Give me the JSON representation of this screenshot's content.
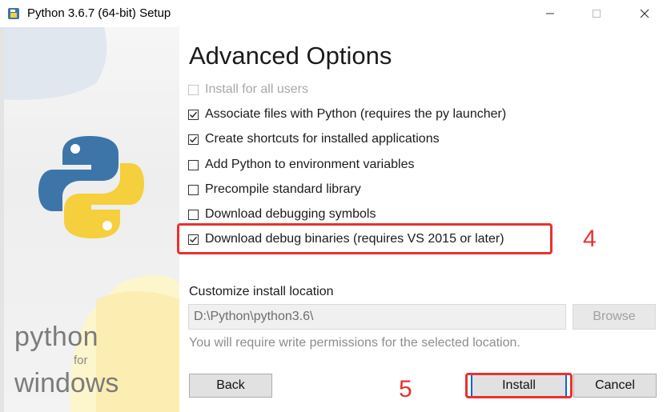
{
  "window": {
    "title": "Python 3.6.7 (64-bit) Setup",
    "icon": "python-setup-icon",
    "controls": {
      "minimize": "minimize-icon",
      "maximize": "maximize-icon",
      "close": "close-icon"
    }
  },
  "banner": {
    "word_python": "python",
    "word_for": "for",
    "word_windows": "windows"
  },
  "page": {
    "heading": "Advanced Options"
  },
  "options": [
    {
      "label": "Install for all users",
      "checked": false,
      "enabled": false
    },
    {
      "label": "Associate files with Python (requires the py launcher)",
      "checked": true,
      "enabled": true
    },
    {
      "label": "Create shortcuts for installed applications",
      "checked": true,
      "enabled": true
    },
    {
      "label": "Add Python to environment variables",
      "checked": false,
      "enabled": true
    },
    {
      "label": "Precompile standard library",
      "checked": false,
      "enabled": true
    },
    {
      "label": "Download debugging symbols",
      "checked": false,
      "enabled": true
    },
    {
      "label": "Download debug binaries (requires VS 2015 or later)",
      "checked": true,
      "enabled": true
    }
  ],
  "install_location": {
    "label": "Customize install location",
    "value": "D:\\Python\\python3.6\\",
    "browse_label": "Browse",
    "note": "You will require write permissions for the selected location."
  },
  "buttons": {
    "back": "Back",
    "install": "Install",
    "cancel": "Cancel"
  },
  "annotations": {
    "step_4": "4",
    "step_5": "5",
    "color": "#e8322f"
  },
  "colors": {
    "python_blue": "#3d75a8",
    "python_yellow": "#f5cf3c",
    "accent_focus": "#0a64d8"
  }
}
